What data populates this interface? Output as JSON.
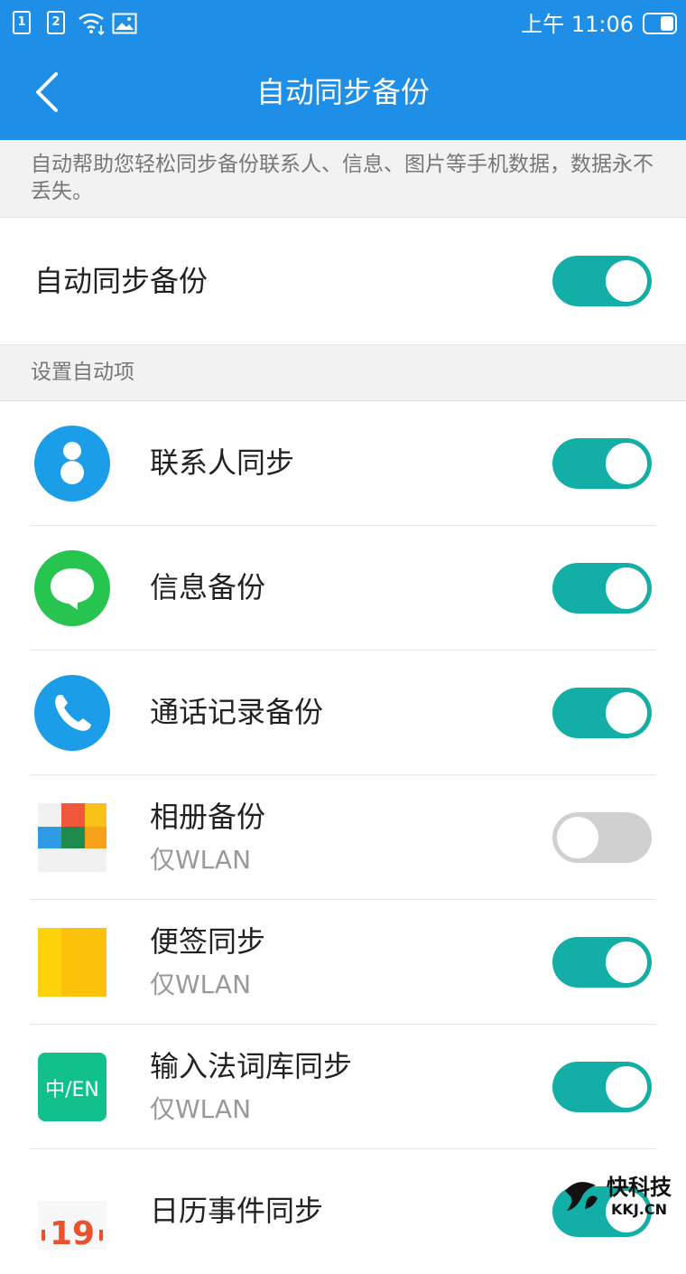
{
  "status_bar": {
    "sim1": "1",
    "sim2": "2",
    "time": "上午 11:06"
  },
  "header": {
    "title": "自动同步备份"
  },
  "description": "自动帮助您轻松同步备份联系人、信息、图片等手机数据，数据永不丢失。",
  "master": {
    "label": "自动同步备份",
    "enabled": true
  },
  "section": {
    "label": "设置自动项"
  },
  "items": [
    {
      "name": "联系人同步",
      "sub": "",
      "enabled": true,
      "icon": "contacts-icon"
    },
    {
      "name": "信息备份",
      "sub": "",
      "enabled": true,
      "icon": "message-icon"
    },
    {
      "name": "通话记录备份",
      "sub": "",
      "enabled": true,
      "icon": "phone-icon"
    },
    {
      "name": "相册备份",
      "sub": "仅WLAN",
      "enabled": false,
      "icon": "album-icon"
    },
    {
      "name": "便签同步",
      "sub": "仅WLAN",
      "enabled": true,
      "icon": "notes-icon"
    },
    {
      "name": "输入法词库同步",
      "sub": "仅WLAN",
      "enabled": true,
      "icon": "input-method-icon",
      "icon_text": "中/EN"
    },
    {
      "name": "日历事件同步",
      "sub": "",
      "enabled": true,
      "icon": "calendar-icon",
      "icon_text": "19"
    }
  ],
  "watermark": {
    "text": "快科技",
    "sub": "KKJ.CN"
  },
  "colors": {
    "header": "#1e8ee6",
    "toggle_on": "#13aea6",
    "toggle_off": "#d0d0d0"
  }
}
